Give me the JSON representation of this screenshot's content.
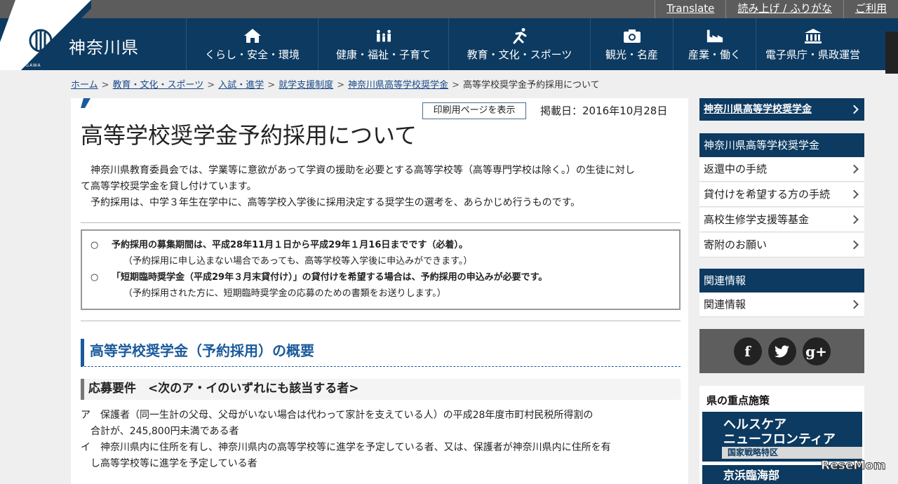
{
  "util": {
    "translate": "Translate",
    "readaloud": "読み上げ / ふりがな",
    "usage": "ご利用"
  },
  "header": {
    "logo_text": "神奈川県",
    "logo_small": "KANAGAWA",
    "nav": [
      {
        "label": "くらし・安全・環境",
        "icon": "house-icon"
      },
      {
        "label": "健康・福祉・子育て",
        "icon": "family-icon"
      },
      {
        "label": "教育・文化・スポーツ",
        "icon": "runner-icon"
      },
      {
        "label": "観光・名産",
        "icon": "camera-icon"
      },
      {
        "label": "産業・働く",
        "icon": "factory-icon"
      },
      {
        "label": "電子県庁・県政運営",
        "icon": "government-building-icon"
      }
    ]
  },
  "breadcrumb": {
    "items": [
      "ホーム",
      "教育・文化・スポーツ",
      "入試・進学",
      "就学支援制度",
      "神奈川県高等学校奨学金"
    ],
    "current": "高等学校奨学金予約採用について",
    "separator": ">"
  },
  "main": {
    "print_label": "印刷用ページを表示",
    "pub_date": "掲載日：2016年10月28日",
    "title": "高等学校奨学金予約採用について",
    "intro": [
      "神奈川県教育委員会では、学業等に意欲があって学資の援助を必要とする高等学校等（高等専門学校は除く。）の生徒に対して高等学校奨学金を貸し付けています。",
      "予約採用は、中学３年生在学中に、高等学校入学後に採用決定する奨学生の選考を、あらかじめ行うものです。"
    ],
    "intro_line1a": "神奈川県教育委員会では、学業等に意欲があって学資の援助を必要とする高等学校等（高等専門学校は除く。）の生徒に対し",
    "intro_line1b": "て高等学校奨学金を貸し付けています。",
    "notice": {
      "bullet": "○",
      "item1": "予約採用の募集期間は、平成28年11月１日から平成29年１月16日までです（必着）。",
      "item1_sub": "（予約採用に申し込まない場合であっても、高等学校等入学後に申込みができます。）",
      "item2": "「短期臨時奨学金（平成29年３月末貸付け）」の貸付けを希望する場合は、予約採用の申込みが必要です。",
      "item2_sub": "（予約採用された方に、短期臨時奨学金の応募のための書類をお送りします。）"
    },
    "h2": "高等学校奨学金（予約採用）の概要",
    "h3": "応募要件　<次のア・イのいずれにも該当する者>",
    "req_a1": "ア　保護者（同一生計の父母、父母がいない場合は代わって家計を支えている人）の平成28年度市町村民税所得割の",
    "req_a2": "合計が、245,800円未満である者",
    "req_b1": "イ　神奈川県内に住所を有し、神奈川県内の高等学校等に進学を予定している者、又は、保護者が神奈川県内に住所を有",
    "req_b2": "し高等学校等に進学を予定している者"
  },
  "sidebar": {
    "top_link": "神奈川県高等学校奨学金",
    "section1_head": "神奈川県高等学校奨学金",
    "section1_items": [
      "返還中の手続",
      "貸付けを希望する方の手続",
      "高校生修学支援等基金",
      "寄附のお願い"
    ],
    "section2_head": "関連情報",
    "section2_items": [
      "関連情報"
    ],
    "social": [
      "f",
      "t",
      "g+"
    ],
    "priority_title": "県の重点施策",
    "banner1_l1": "ヘルスケア",
    "banner1_l2": "ニューフロンティア",
    "banner1_l3": "国家戦略特区",
    "banner2": "京浜臨海部"
  },
  "watermark": "ReseMom",
  "colors": {
    "header": "#0c3a61",
    "accent": "#1a5a9c",
    "util": "#5c5c5c"
  }
}
